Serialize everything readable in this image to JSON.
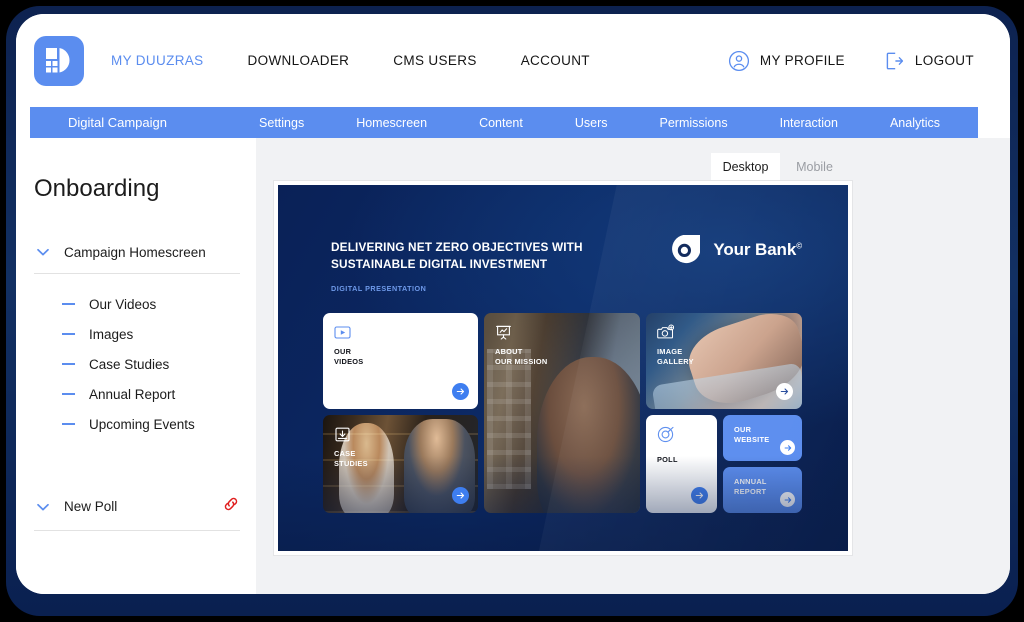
{
  "header": {
    "logo_name": "duuzras-logo",
    "nav": [
      {
        "label": "MY DUUZRAS",
        "active": true
      },
      {
        "label": "DOWNLOADER",
        "active": false
      },
      {
        "label": "CMS USERS",
        "active": false
      },
      {
        "label": "ACCOUNT",
        "active": false
      }
    ],
    "profile_label": "MY PROFILE",
    "logout_label": "LOGOUT"
  },
  "subnav": {
    "title": "Digital Campaign",
    "items": [
      {
        "label": "Settings"
      },
      {
        "label": "Homescreen"
      },
      {
        "label": "Content"
      },
      {
        "label": "Users"
      },
      {
        "label": "Permissions"
      },
      {
        "label": "Interaction"
      },
      {
        "label": "Analytics"
      }
    ],
    "background": "#5b8def"
  },
  "sidebar": {
    "title": "Onboarding",
    "groups": [
      {
        "label": "Campaign Homescreen",
        "expanded": true,
        "has_link_icon": false,
        "children": [
          {
            "label": "Our Videos"
          },
          {
            "label": "Images"
          },
          {
            "label": "Case Studies"
          },
          {
            "label": "Annual Report"
          },
          {
            "label": "Upcoming Events"
          }
        ]
      },
      {
        "label": "New Poll",
        "expanded": true,
        "has_link_icon": true,
        "link_icon_color": "#e02020",
        "children": []
      }
    ]
  },
  "preview": {
    "tabs": [
      {
        "label": "Desktop",
        "active": true
      },
      {
        "label": "Mobile",
        "active": false
      }
    ],
    "slide": {
      "headline": "DELIVERING NET ZERO OBJECTIVES WITH SUSTAINABLE DIGITAL INVESTMENT",
      "subtitle": "DIGITAL PRESENTATION",
      "brand_name": "Your Bank",
      "brand_mark": "©",
      "background": "#0b2558",
      "accent": "#3e7ef0",
      "tiles": [
        {
          "id": "our-videos",
          "label": "OUR\nVIDEOS",
          "style": "white",
          "icon": "video-icon"
        },
        {
          "id": "about-mission",
          "label": "ABOUT\nOUR MISSION",
          "style": "photo",
          "icon": "presentation-icon"
        },
        {
          "id": "image-gallery",
          "label": "IMAGE\nGALLERY",
          "style": "photo",
          "icon": "camera-icon"
        },
        {
          "id": "case-studies",
          "label": "CASE\nSTUDIES",
          "style": "photo",
          "icon": "briefcase-icon"
        },
        {
          "id": "poll",
          "label": "POLL",
          "style": "white",
          "icon": "poll-icon"
        },
        {
          "id": "our-website",
          "label": "OUR\nWEBSITE",
          "style": "blue",
          "icon": ""
        },
        {
          "id": "annual-report",
          "label": "ANNUAL\nREPORT",
          "style": "blue",
          "icon": ""
        }
      ]
    }
  }
}
